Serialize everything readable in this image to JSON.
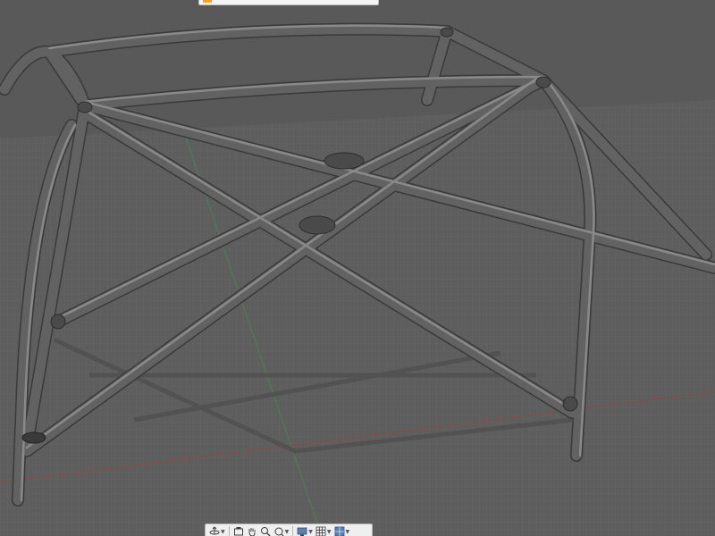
{
  "app": {
    "name": "CAD 3D viewport"
  },
  "viewport": {
    "model": "roll-cage-tube-frame",
    "background_color": "#595959",
    "grid_color": "#6e6e6e",
    "axis_red_color": "#8a4b4b",
    "axis_green_color": "#4e7d52",
    "tube_color": "#5c5c5c"
  },
  "top_widget": {
    "accent_color": "#f2a52b"
  },
  "nav_toolbar": {
    "buttons": [
      {
        "icon": "orbit-icon",
        "has_dropdown": true
      },
      {
        "icon": "look-at-icon",
        "has_dropdown": false
      },
      {
        "icon": "pan-hand-icon",
        "has_dropdown": false
      },
      {
        "icon": "zoom-icon",
        "has_dropdown": false
      },
      {
        "icon": "fit-icon",
        "has_dropdown": true
      },
      {
        "icon": "display-settings-icon",
        "has_dropdown": true
      },
      {
        "icon": "grid-settings-icon",
        "has_dropdown": true
      },
      {
        "icon": "viewports-icon",
        "has_dropdown": true
      }
    ]
  }
}
